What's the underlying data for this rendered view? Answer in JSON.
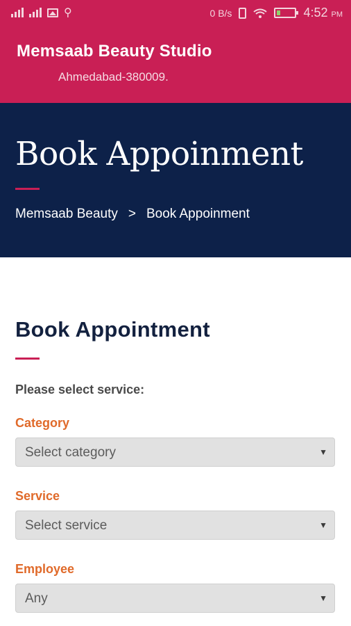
{
  "status_bar": {
    "signal_label_1": "ll",
    "signal_label_2": "ll",
    "network_speed": "0 B/s",
    "time": "4:52",
    "time_suffix": "PM"
  },
  "app_bar": {
    "title": "Memsaab Beauty Studio",
    "peek_text": "Ahmedabad-380009."
  },
  "hero": {
    "title": "Book Appoinment",
    "breadcrumb": [
      "Memsaab Beauty",
      ">",
      "Book Appoinment"
    ]
  },
  "form": {
    "title": "Book Appointment",
    "instructions": "Please select service:",
    "fields": [
      {
        "label": "Category",
        "value": "Select category"
      },
      {
        "label": "Service",
        "value": "Select service"
      },
      {
        "label": "Employee",
        "value": "Any"
      }
    ]
  },
  "colors": {
    "header": "#c91f55",
    "hero": "#0d2149",
    "accent_rule": "#c91f55",
    "field_label": "#e06a2a",
    "select_bg": "#e1e1e1"
  },
  "icons": [
    "signal-icon",
    "image-icon",
    "usb-icon",
    "vibrate-icon",
    "wifi-icon",
    "battery-icon",
    "dropdown-arrow-icon"
  ]
}
